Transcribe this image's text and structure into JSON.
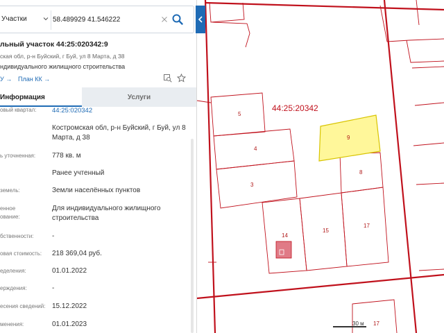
{
  "search": {
    "type_label": "Участки",
    "query": "58.489929 41.546222",
    "icons": {
      "dropdown": "chevron-down-icon",
      "clear": "close-icon",
      "submit": "search-icon",
      "collapse": "chevron-left-icon"
    }
  },
  "object": {
    "title": "льный участок 44:25:020342:9",
    "address": "ская обл, р-н Буйский, г Буй, ул 8 Марта, д 38",
    "permitted_use": "ндивидуального жилищного строительства",
    "link_ku": "У →",
    "link_kk": "План КК →",
    "icons": {
      "map_search": "map-search-icon",
      "favorite": "star-icon"
    }
  },
  "tabs": {
    "info": "Информация",
    "services": "Услуги"
  },
  "rows": [
    {
      "label": "овый квартал:",
      "value": "44:25:020342",
      "link": true
    },
    {
      "label": "",
      "value": "Костромская обл, р-н Буйский, г Буй, ул 8 Марта, д 38"
    },
    {
      "label": "ь уточненная:",
      "value": "778 кв. м"
    },
    {
      "label": "",
      "value": "Ранее учтенный"
    },
    {
      "label": "земель:",
      "value": "Земли населённых пунктов"
    },
    {
      "label": "енное\nование:",
      "value": "Для индивидуального жилищного строительства"
    },
    {
      "label": "бственности:",
      "value": "-"
    },
    {
      "label": "овая стоимость:",
      "value": "218 369,04 руб."
    },
    {
      "label": "еделения:",
      "value": "01.01.2022"
    },
    {
      "label": "ерждения:",
      "value": "-"
    },
    {
      "label": "есения сведений:",
      "value": "15.12.2022"
    },
    {
      "label": "менения:",
      "value": "01.01.2023"
    }
  ],
  "map": {
    "quarter_label": "44:25:20342",
    "parcels": [
      "5",
      "4",
      "3",
      "9",
      "8",
      "14",
      "15",
      "17"
    ],
    "scale_label": "30 м",
    "bottom_parcel": "17",
    "colors": {
      "boundary": "#c0111c",
      "selected_fill": "#fff79a",
      "selected_stroke": "#d8c400",
      "building": "#e07a86"
    }
  }
}
